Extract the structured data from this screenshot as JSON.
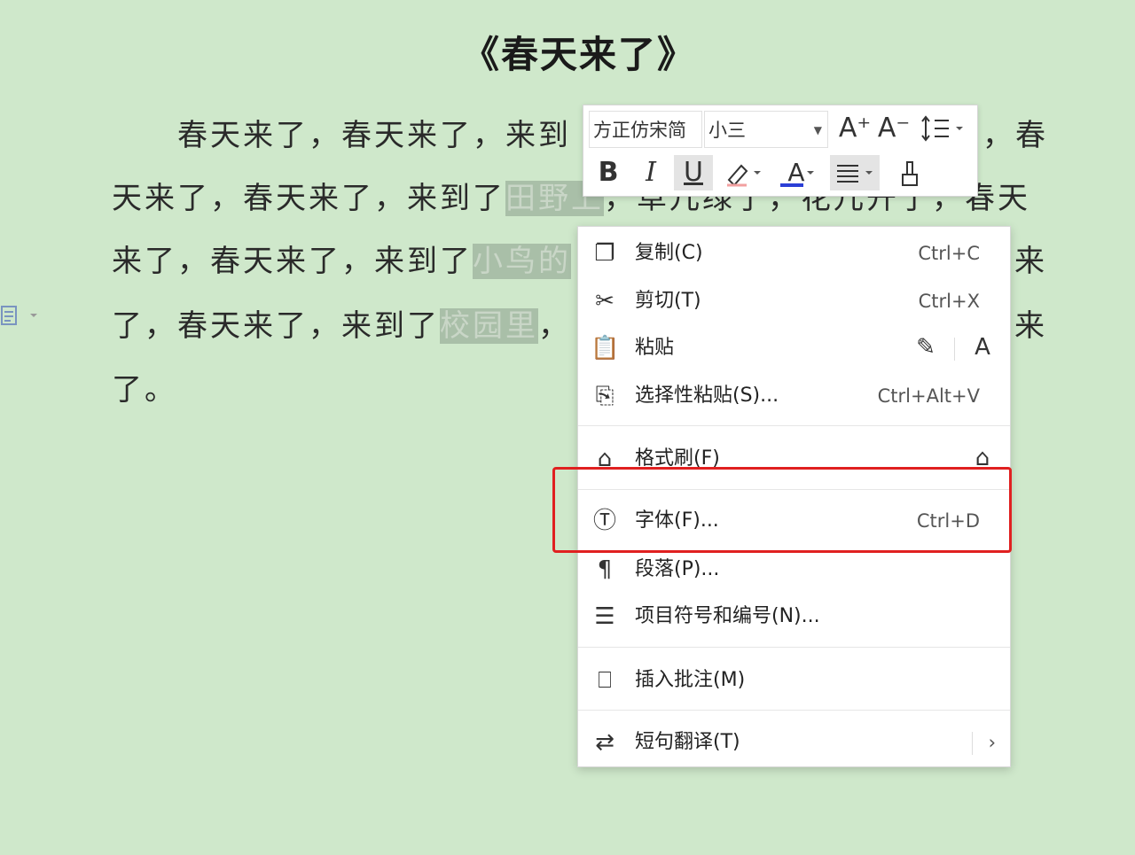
{
  "document": {
    "title": "《春天来了》",
    "lines": [
      {
        "a": "春天来了，春天来了，来到",
        "sel": "",
        "b": ""
      },
      {
        "a": "天来了，春天来了，来到了",
        "sel": "田野上",
        "b": "，草儿绿了，花儿开了，春天"
      },
      {
        "a": "来了，春天来了，来到了",
        "sel": "小鸟的",
        "b": ""
      },
      {
        "a": "了，春天来了，来到了",
        "sel": "校园里",
        "b": "，"
      },
      {
        "a": "了。",
        "sel": "",
        "b": ""
      }
    ],
    "right_chars": [
      "，春",
      "来",
      "来"
    ]
  },
  "mini_toolbar": {
    "font_name": "方正仿宋简",
    "font_size": "小三",
    "grow_font": "A⁺",
    "shrink_font": "A⁻",
    "bold": "B",
    "italic": "I",
    "underline": "U",
    "font_color": "A"
  },
  "context_menu": {
    "items": [
      {
        "label": "复制(C)",
        "shortcut": "Ctrl+C",
        "icon": "copy-icon"
      },
      {
        "label": "剪切(T)",
        "shortcut": "Ctrl+X",
        "icon": "scissors-icon"
      },
      {
        "label": "粘贴",
        "shortcut": "",
        "icon": "paste-icon"
      },
      {
        "label": "选择性粘贴(S)...",
        "shortcut": "Ctrl+Alt+V",
        "icon": "paste-special-icon"
      },
      {
        "label": "格式刷(F)",
        "shortcut": "",
        "icon": "format-brush-icon"
      },
      {
        "label": "字体(F)...",
        "shortcut": "Ctrl+D",
        "icon": "font-icon"
      },
      {
        "label": "段落(P)...",
        "shortcut": "",
        "icon": "paragraph-icon"
      },
      {
        "label": "项目符号和编号(N)...",
        "shortcut": "",
        "icon": "bullets-icon"
      },
      {
        "label": "插入批注(M)",
        "shortcut": "",
        "icon": "comment-icon"
      },
      {
        "label": "短句翻译(T)",
        "shortcut": "",
        "icon": "translate-icon"
      }
    ],
    "submenu_arrow": "›"
  },
  "colors": {
    "background": "#cfe8cb",
    "highlight_box": "#e02020",
    "selection": "#a9bfa8"
  }
}
